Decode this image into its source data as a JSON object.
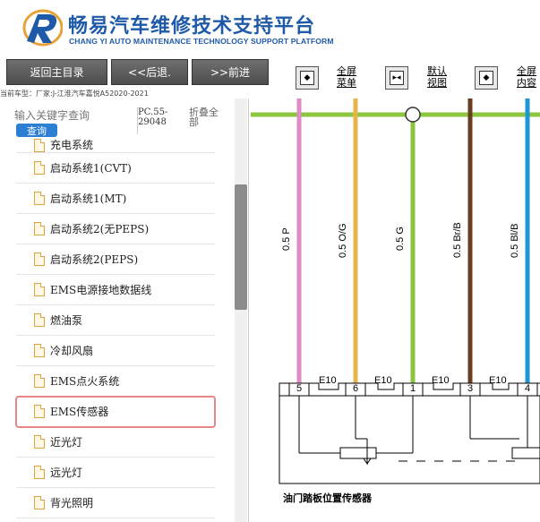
{
  "header": {
    "title_cn": "畅易汽车维修技术支持平台",
    "title_en": "CHANG YI AUTO MAINTENANCE TECHNOLOGY SUPPORT PLATFORM",
    "brand_color": "#1f5aa8"
  },
  "toolbar": {
    "back_main": "返回主目录",
    "back": "<<后退.",
    "forward": ">>前进",
    "full_menu": [
      "全屏",
      "菜单"
    ],
    "default_view": [
      "默认",
      "视图"
    ],
    "full_content": [
      "全屏",
      "内容"
    ]
  },
  "vehicle_info": "当前车型：厂家:J-江淮汽车嘉悦A52020-2021",
  "search": {
    "placeholder": "输入关键字查询",
    "button": "查询",
    "pc_code": [
      "PC.55-",
      "29048"
    ],
    "collapse_all": [
      "折叠全",
      "部"
    ]
  },
  "tree": {
    "items": [
      {
        "label": "充电系统",
        "partial": true
      },
      {
        "label": "启动系统1(CVT)"
      },
      {
        "label": "启动系统1(MT)"
      },
      {
        "label": "启动系统2(无PEPS)"
      },
      {
        "label": "启动系统2(PEPS)"
      },
      {
        "label": "EMS电源接地数据线"
      },
      {
        "label": "燃油泵"
      },
      {
        "label": "冷却风扇"
      },
      {
        "label": "EMS点火系统"
      },
      {
        "label": "EMS传感器",
        "highlight": true
      },
      {
        "label": "近光灯"
      },
      {
        "label": "远光灯"
      },
      {
        "label": "背光照明"
      }
    ]
  },
  "diagram": {
    "wires": [
      {
        "label": "0.5 P",
        "color": "#e38ac6",
        "pin": "5"
      },
      {
        "label": "0.5 O/G",
        "color": "#e8b54a",
        "pin": "6"
      },
      {
        "label": "0.5 G",
        "color": "#8cc63f",
        "pin": "1"
      },
      {
        "label": "0.5 Br/B",
        "color": "#6b3d1f",
        "pin": "3"
      },
      {
        "label": "0.5 Bl/B",
        "color": "#2196d6",
        "pin": "4"
      }
    ],
    "connector_label": "E10",
    "sensor_name": "油门踏板位置传感器"
  }
}
